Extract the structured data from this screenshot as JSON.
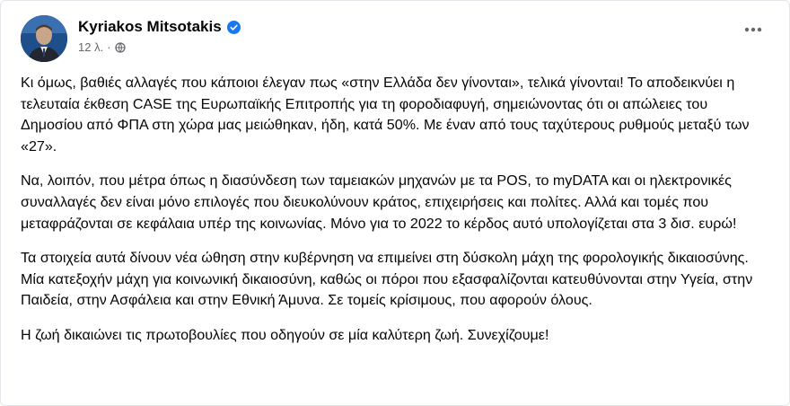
{
  "post": {
    "author": {
      "name": "Kyriakos Mitsotakis",
      "verified_icon": "verified-badge-icon",
      "verified_color": "#1877f2"
    },
    "timestamp": "12 λ.",
    "separator": "·",
    "audience_icon": "globe-icon",
    "more_icon": "more-options-icon",
    "paragraphs": [
      "Κι όμως, βαθιές αλλαγές που κάποιοι έλεγαν πως «στην Ελλάδα δεν γίνονται», τελικά γίνονται! Το αποδεικνύει η τελευταία έκθεση CASE της Ευρωπαϊκής Επιτροπής για τη φοροδιαφυγή, σημειώνοντας ότι οι απώλειες του Δημοσίου από ΦΠΑ στη χώρα μας μειώθηκαν, ήδη, κατά 50%. Με έναν από τους ταχύτερους ρυθμούς μεταξύ των «27».",
      "Να, λοιπόν, που μέτρα όπως η διασύνδεση των ταμειακών μηχανών με τα POS, το myDATA και οι ηλεκτρονικές συναλλαγές δεν είναι μόνο επιλογές που διευκολύνουν κράτος, επιχειρήσεις και πολίτες. Αλλά και τομές που μεταφράζονται σε κεφάλαια υπέρ της κοινωνίας. Μόνο για το 2022 το κέρδος αυτό υπολογίζεται στα 3 δισ. ευρώ!",
      "Τα στοιχεία αυτά δίνουν νέα ώθηση στην κυβέρνηση να επιμείνει στη δύσκολη μάχη της φορολογικής δικαιοσύνης. Μία κατεξοχήν μάχη για κοινωνική δικαιοσύνη, καθώς οι πόροι που εξασφαλίζονται κατευθύνονται στην Υγεία, στην Παιδεία, στην Ασφάλεια και στην Εθνική Άμυνα. Σε τομείς κρίσιμους, που αφορούν όλους.",
      "Η ζωή δικαιώνει τις πρωτοβουλίες που οδηγούν σε μία καλύτερη ζωή. Συνεχίζουμε!"
    ]
  }
}
